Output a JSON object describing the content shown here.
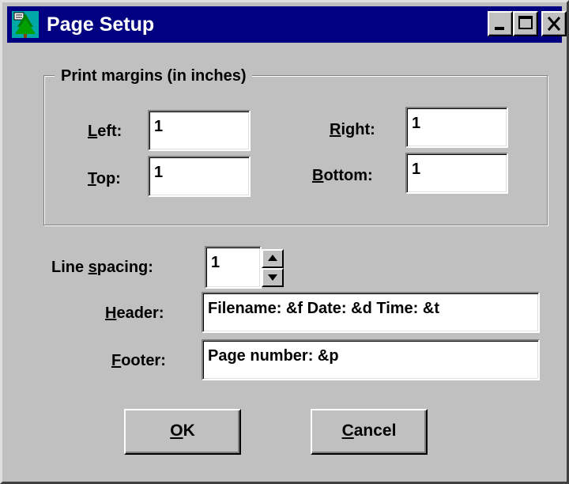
{
  "window": {
    "title": "Page Setup",
    "controls": {
      "minimize": "minimize-icon",
      "maximize": "maximize-icon",
      "close": "close-icon"
    }
  },
  "margins": {
    "group_title": "Print margins (in inches)",
    "left": {
      "mnemonic": "L",
      "rest": "eft:",
      "value": "1"
    },
    "right": {
      "mnemonic": "R",
      "rest": "ight:",
      "value": "1"
    },
    "top": {
      "mnemonic": "T",
      "rest": "op:",
      "value": "1"
    },
    "bottom": {
      "mnemonic": "B",
      "rest": "ottom:",
      "value": "1"
    }
  },
  "line_spacing": {
    "pre": "Line ",
    "mnemonic": "s",
    "rest": "pacing:",
    "value": "1"
  },
  "header": {
    "mnemonic": "H",
    "rest": "eader:",
    "value": "Filename: &f Date: &d Time: &t"
  },
  "footer": {
    "mnemonic": "F",
    "rest": "ooter:",
    "value": "Page number: &p"
  },
  "buttons": {
    "ok": {
      "mnemonic": "O",
      "rest": "K"
    },
    "cancel": {
      "mnemonic": "C",
      "rest": "ancel"
    }
  },
  "colors": {
    "titlebar": "#000080",
    "face": "#c0c0c0",
    "field": "#ffffff"
  }
}
